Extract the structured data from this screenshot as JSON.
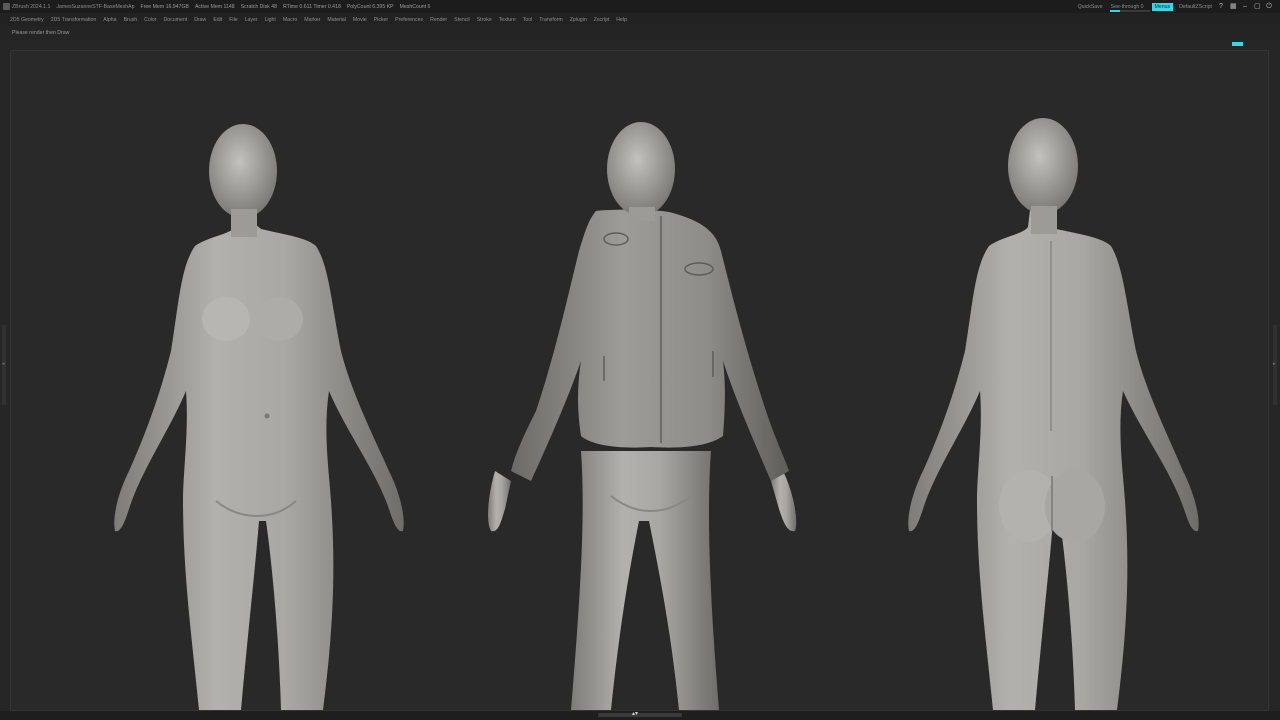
{
  "titlebar": {
    "app": "ZBrush 2024.1.1",
    "project": "JamesSuzanneSTF-BaseMeshAp",
    "free_mem": "Free Mem 16.947GB",
    "active_mem": "Active Mem 1148",
    "scratch_disk": "Scratch Disk 48",
    "timer": "RTime 0.611 Timer 0.418",
    "poly_count": "PolyCount 6.395 KP",
    "mesh_count": "MeshCount 6"
  },
  "toolbar_right": {
    "quicksave": "QuickSave",
    "see_through_label": "See-through 0",
    "see_through_fraction": 0.25,
    "menus_label": "Menus",
    "default_script": "DefaultZScript",
    "icons": [
      "help-icon",
      "layout-icon",
      "minimize-icon",
      "window-icon",
      "power-icon"
    ],
    "accent_color": "#3ad6e6"
  },
  "menubar": {
    "items": [
      "2D5 Geometry",
      "2D5 Transformation",
      "Alpha",
      "Brush",
      "Color",
      "Document",
      "Draw",
      "Edit",
      "File",
      "Layer",
      "Light",
      "Macro",
      "Marker",
      "Material",
      "Movie",
      "Picker",
      "Preferences",
      "Render",
      "Stencil",
      "Stroke",
      "Texture",
      "Tool",
      "Transform",
      "Zplugin",
      "Zscript",
      "Help"
    ]
  },
  "note": {
    "text": "Please render then Draw"
  },
  "viewport": {
    "background": "#292929",
    "figures": [
      "front-nude",
      "front-jacket",
      "back-nude"
    ]
  }
}
